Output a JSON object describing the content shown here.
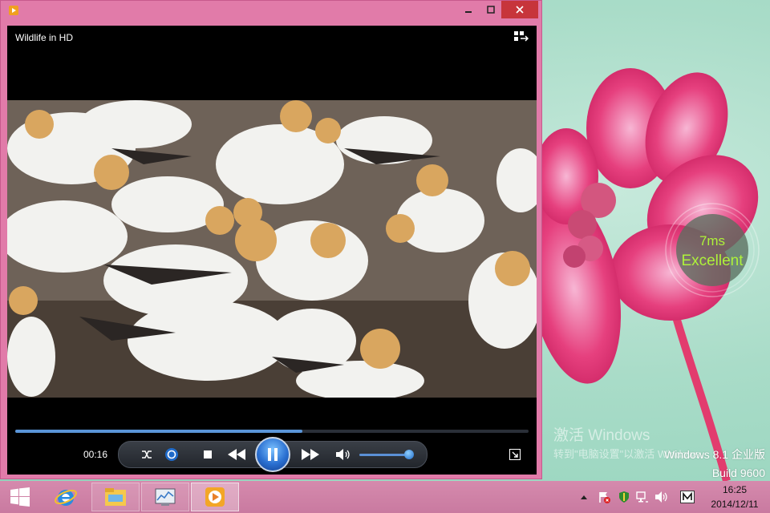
{
  "player": {
    "video_title": "Wildlife in HD",
    "elapsed": "00:16",
    "progress": 0.56,
    "volume": 0.9
  },
  "overlay": {
    "ping": "7ms",
    "quality": "Excellent"
  },
  "watermark": {
    "title": "激活 Windows",
    "subtitle": "转到\"电脑设置\"以激活 Windows。",
    "version": "Windows 8.1 企业版",
    "build": "Build 9600"
  },
  "taskbar": {
    "pinned": [
      "ie-icon",
      "file-explorer-icon",
      "performance-monitor-icon",
      "media-player-icon"
    ],
    "clock_time": "16:25",
    "clock_date": "2014/12/11"
  },
  "colors": {
    "window_frame": "#e17ba9",
    "close_button": "#c7353b",
    "seek_fill": "#5a95d8",
    "overlay_text": "#aef23a"
  }
}
